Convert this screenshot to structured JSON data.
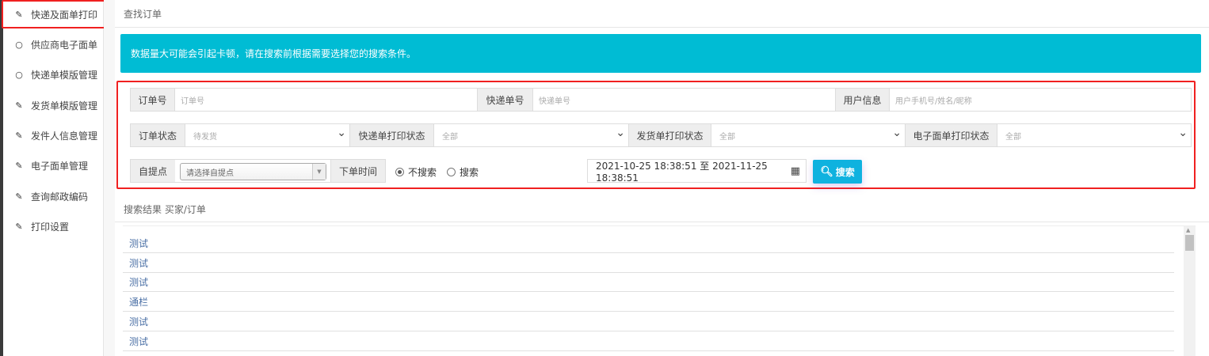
{
  "sidebar": {
    "items": [
      {
        "label": "快递及面单打印",
        "icon": "pencil-icon",
        "active": true
      },
      {
        "label": "供应商电子面单",
        "icon": "circle-icon"
      },
      {
        "label": "快递单模版管理",
        "icon": "circle-icon"
      },
      {
        "label": "发货单模版管理",
        "icon": "edit-icon"
      },
      {
        "label": "发件人信息管理",
        "icon": "edit-icon"
      },
      {
        "label": "电子面单管理",
        "icon": "edit-icon"
      },
      {
        "label": "查询邮政编码",
        "icon": "edit-icon"
      },
      {
        "label": "打印设置",
        "icon": "edit-icon"
      }
    ]
  },
  "header": {
    "title": "查找订单"
  },
  "alert": {
    "text": "数据量大可能会引起卡顿，请在搜索前根据需要选择您的搜索条件。",
    "color": "#00bcd4"
  },
  "filters": {
    "order_no": {
      "label": "订单号",
      "placeholder": "订单号"
    },
    "express_no": {
      "label": "快递单号",
      "placeholder": "快递单号"
    },
    "user_info": {
      "label": "用户信息",
      "placeholder": "用户手机号/姓名/昵称"
    },
    "order_status": {
      "label": "订单状态",
      "value": "待发货"
    },
    "express_print_status": {
      "label": "快递单打印状态",
      "value": "全部"
    },
    "ship_print_status": {
      "label": "发货单打印状态",
      "value": "全部"
    },
    "eorder_print_status": {
      "label": "电子面单打印状态",
      "value": "全部"
    },
    "pickup": {
      "label": "自提点",
      "placeholder": "请选择自提点"
    },
    "order_time": {
      "label": "下单时间",
      "radio_no": "不搜索",
      "radio_yes": "搜索",
      "selected": "不搜索"
    },
    "date_range": "2021-10-25 18:38:51 至 2021-11-25 18:38:51",
    "search_label": "搜索"
  },
  "results": {
    "title": "搜索结果 买家/订单",
    "rows": [
      "测试",
      "测试",
      "测试",
      "通栏",
      "测试",
      "测试"
    ]
  },
  "colors": {
    "highlight": "#f02020",
    "button": "#0fb2df"
  }
}
